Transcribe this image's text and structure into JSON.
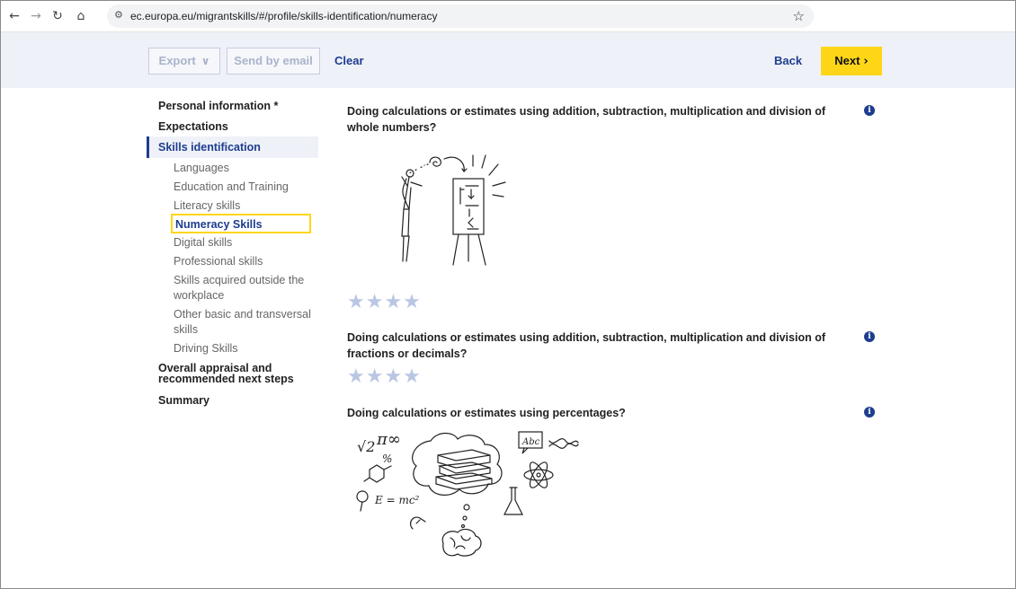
{
  "browser": {
    "url": "ec.europa.eu/migrantskills/#/profile/skills-identification/numeracy",
    "icons": [
      "back-arrow-icon",
      "forward-arrow-icon",
      "reload-icon",
      "home-icon",
      "site-settings-icon",
      "bookmark-star-icon"
    ]
  },
  "toolbar": {
    "export_label": "Export",
    "email_label": "Send by email",
    "clear_label": "Clear",
    "back_label": "Back",
    "next_label": "Next"
  },
  "sidebar": {
    "personal_info": "Personal information *",
    "expectations": "Expectations",
    "skills_identification": "Skills identification",
    "sub_items": [
      "Languages",
      "Education and Training",
      "Literacy skills",
      "Numeracy Skills",
      "Digital skills",
      "Professional skills",
      "Skills acquired outside the",
      "workplace",
      "Other basic and transversal",
      "skills",
      "Driving Skills"
    ],
    "overall_line1": "Overall appraisal and",
    "overall_line2": "recommended next steps",
    "summary": "Summary"
  },
  "questions": [
    {
      "text": "Doing calculations or estimates using addition, subtraction, multiplication and division of whole numbers?",
      "stars": "★★★★",
      "rating_filled": 0,
      "rating_max": 4
    },
    {
      "text": "Doing calculations or estimates using addition, subtraction, multiplication and division of fractions or decimals?",
      "stars": "★★★★",
      "rating_filled": 0,
      "rating_max": 4
    },
    {
      "text": "Doing calculations or estimates using percentages?"
    }
  ],
  "illustration_text": {
    "formula": "E = mc²",
    "pi_inf": "π∞",
    "sqrt2": "√2",
    "percent": "%",
    "abc": "Abc"
  },
  "colors": {
    "primary": "#1d3d8f",
    "accent": "#ffd617",
    "toolbar_bg": "#eef1f7",
    "star_empty": "#b9c7e3"
  }
}
